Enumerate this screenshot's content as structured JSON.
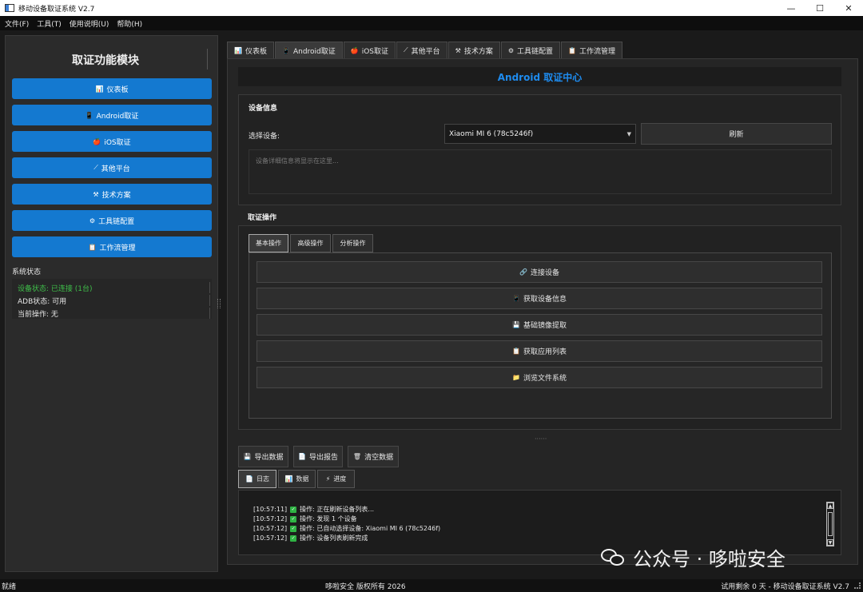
{
  "window": {
    "title": "移动设备取证系统 V2.7",
    "minimize": "—",
    "maximize": "☐",
    "close": "✕"
  },
  "menubar": [
    "文件(F)",
    "工具(T)",
    "使用说明(U)",
    "帮助(H)"
  ],
  "sidebar": {
    "title": "取证功能模块",
    "items": [
      {
        "icon": "📊",
        "label": "仪表板"
      },
      {
        "icon": "📱",
        "label": "Android取证"
      },
      {
        "icon": "🍎",
        "label": "iOS取证"
      },
      {
        "icon": "⟋",
        "label": "其他平台"
      },
      {
        "icon": "⚒",
        "label": "技术方案"
      },
      {
        "icon": "⚙",
        "label": "工具链配置"
      },
      {
        "icon": "📋",
        "label": "工作流管理"
      }
    ],
    "status_label": "系统状态",
    "status_lines": [
      "设备状态: 已连接 (1台)",
      "ADB状态: 可用",
      "当前操作: 无"
    ],
    "status_colors": {
      "connected": "#3fbf4a"
    }
  },
  "tabs": [
    {
      "icon": "📊",
      "label": "仪表板"
    },
    {
      "icon": "📱",
      "label": "Android取证"
    },
    {
      "icon": "🍎",
      "label": "iOS取证"
    },
    {
      "icon": "⟋",
      "label": "其他平台"
    },
    {
      "icon": "⚒",
      "label": "技术方案"
    },
    {
      "icon": "⚙",
      "label": "工具链配置"
    },
    {
      "icon": "📋",
      "label": "工作流管理"
    }
  ],
  "active_tab": "Android取证",
  "main": {
    "center_title": "Android 取证中心",
    "device_info": {
      "group_title": "设备信息",
      "select_label": "选择设备:",
      "selected_device": "Xiaomi MI 6 (78c5246f)",
      "refresh_button": "刷新",
      "details_placeholder": "设备详细信息将显示在这里..."
    },
    "forensics": {
      "group_title": "取证操作",
      "subtabs": [
        "基本操作",
        "高级操作",
        "分析操作"
      ],
      "operations": [
        {
          "icon": "🔗",
          "label": "连接设备"
        },
        {
          "icon": "📱",
          "label": "获取设备信息"
        },
        {
          "icon": "💾",
          "label": "基础镜像提取"
        },
        {
          "icon": "📋",
          "label": "获取应用列表"
        },
        {
          "icon": "📁",
          "label": "浏览文件系统"
        }
      ]
    },
    "splitter_dots": "······",
    "export_buttons": [
      {
        "icon": "💾",
        "label": "导出数据"
      },
      {
        "icon": "📄",
        "label": "导出报告"
      },
      {
        "icon": "🗑",
        "label": "清空数据"
      }
    ],
    "bottom_tabs": [
      {
        "icon": "📄",
        "label": "日志"
      },
      {
        "icon": "📊",
        "label": "数据"
      },
      {
        "icon": "⚡",
        "label": "进度"
      }
    ],
    "log": [
      {
        "time": "[10:57:11]",
        "text": "操作: 正在刷新设备列表..."
      },
      {
        "time": "[10:57:12]",
        "text": "操作: 发现 1 个设备"
      },
      {
        "time": "[10:57:12]",
        "text": "操作: 已自动选择设备: Xiaomi MI 6 (78c5246f)"
      },
      {
        "time": "[10:57:12]",
        "text": "操作: 设备列表刷新完成"
      }
    ]
  },
  "watermark": "公众号 · 哆啦安全",
  "statusbar": {
    "left": "就绪",
    "center": "哆啦安全 版权所有 2026",
    "right": "试用剩余 0 天 - 移动设备取证系统 V2.7"
  },
  "colors": {
    "accent": "#1479d0",
    "title_blue": "#1e8cf0",
    "background": "#1a1a1a"
  }
}
